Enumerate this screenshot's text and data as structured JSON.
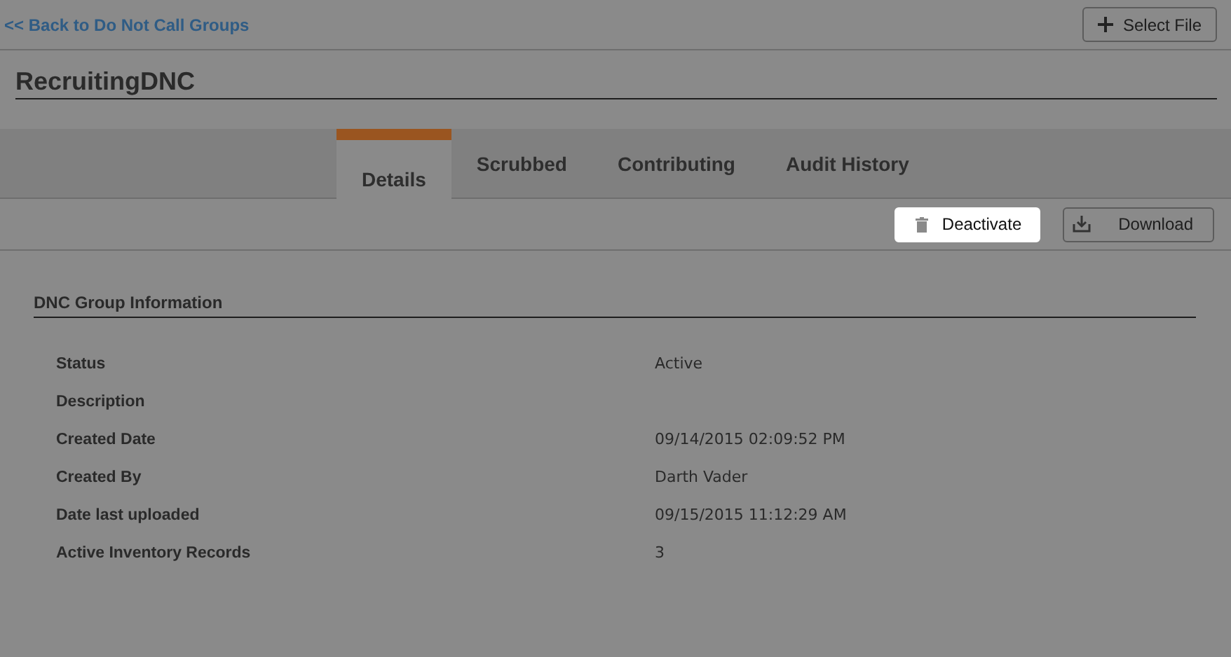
{
  "back_link": "<< Back to Do Not Call Groups",
  "toolbar_buttons": [
    {
      "label": "Select File",
      "kind": "add"
    }
  ],
  "title": "RecruitingDNC",
  "tabs": [
    {
      "label": "Details",
      "selected": true
    },
    {
      "label": "Scrubbed",
      "selected": false
    },
    {
      "label": "Contributing",
      "selected": false
    },
    {
      "label": "Audit History",
      "selected": false
    }
  ],
  "actions": [
    {
      "label": "Deactivate",
      "kind": "delete",
      "highlighted": true
    },
    {
      "label": "Download",
      "kind": "download",
      "highlighted": false
    }
  ],
  "section": {
    "title": "DNC Group Information",
    "fields": [
      {
        "label": "Status",
        "value": "Active"
      },
      {
        "label": "Description"
      },
      {
        "label": "Created Date",
        "value": "09/14/2015 02:09:52 PM"
      },
      {
        "label": "Created By",
        "value": "Darth Vader"
      },
      {
        "label": "Date last uploaded",
        "value": "09/15/2015 11:12:29 AM"
      },
      {
        "label": "Active Inventory Records",
        "value": "3"
      }
    ]
  }
}
